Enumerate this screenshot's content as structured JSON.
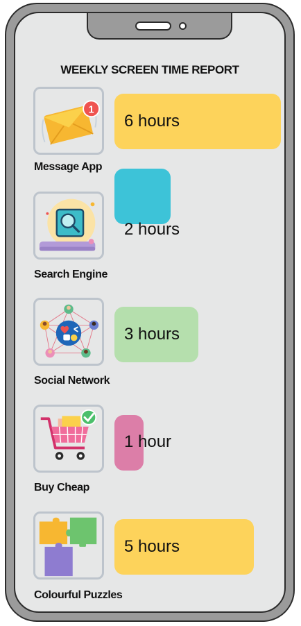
{
  "report": {
    "title": "WEEKLY SCREEN TIME REPORT"
  },
  "chart_data": {
    "type": "bar",
    "orientation": "horizontal",
    "title": "WEEKLY SCREEN TIME REPORT",
    "categories": [
      "Message App",
      "Search Engine",
      "Social Network",
      "Buy Cheap",
      "Colourful Puzzles"
    ],
    "values": [
      6,
      2,
      3,
      1,
      5
    ],
    "unit": "hours",
    "data_labels": [
      "6 hours",
      "2 hours",
      "3 hours",
      "1 hour",
      "5 hours"
    ],
    "colors": [
      "#fdd35b",
      "#3dc3d8",
      "#b5dfad",
      "#dc7ea8",
      "#fdd35b"
    ],
    "icons": [
      "mail-notification-icon",
      "search-magnifier-icon",
      "social-network-icon",
      "shopping-cart-icon",
      "puzzle-pieces-icon"
    ],
    "notification_badge": "1"
  }
}
